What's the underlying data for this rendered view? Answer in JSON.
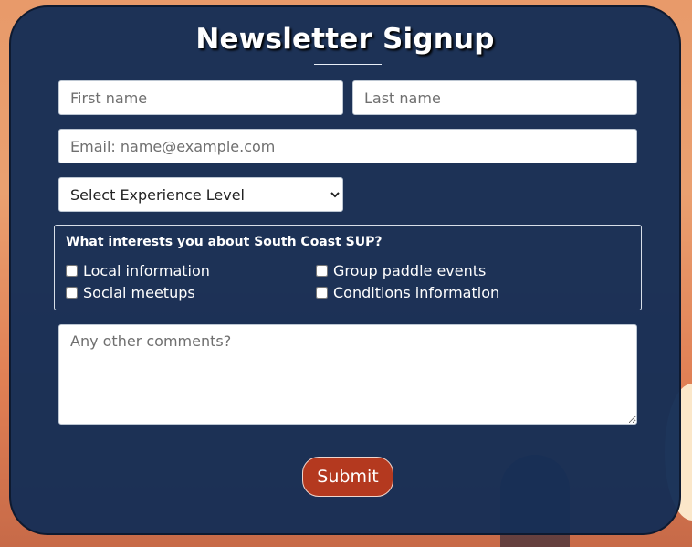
{
  "form": {
    "title": "Newsletter Signup",
    "first_name": {
      "placeholder": "First name",
      "value": ""
    },
    "last_name": {
      "placeholder": "Last name",
      "value": ""
    },
    "email": {
      "placeholder": "Email: name@example.com",
      "value": ""
    },
    "experience": {
      "selected": "Select Experience Level"
    },
    "interests": {
      "legend": "What interests you about South Coast SUP?",
      "options": [
        {
          "label": "Local information",
          "checked": false
        },
        {
          "label": "Group paddle events",
          "checked": false
        },
        {
          "label": "Social meetups",
          "checked": false
        },
        {
          "label": "Conditions information",
          "checked": false
        }
      ]
    },
    "comments": {
      "placeholder": "Any other comments?",
      "value": ""
    },
    "submit_label": "Submit"
  },
  "colors": {
    "card_background": "#162e56",
    "submit_button": "#b4391f",
    "text_light": "#ffffff"
  }
}
